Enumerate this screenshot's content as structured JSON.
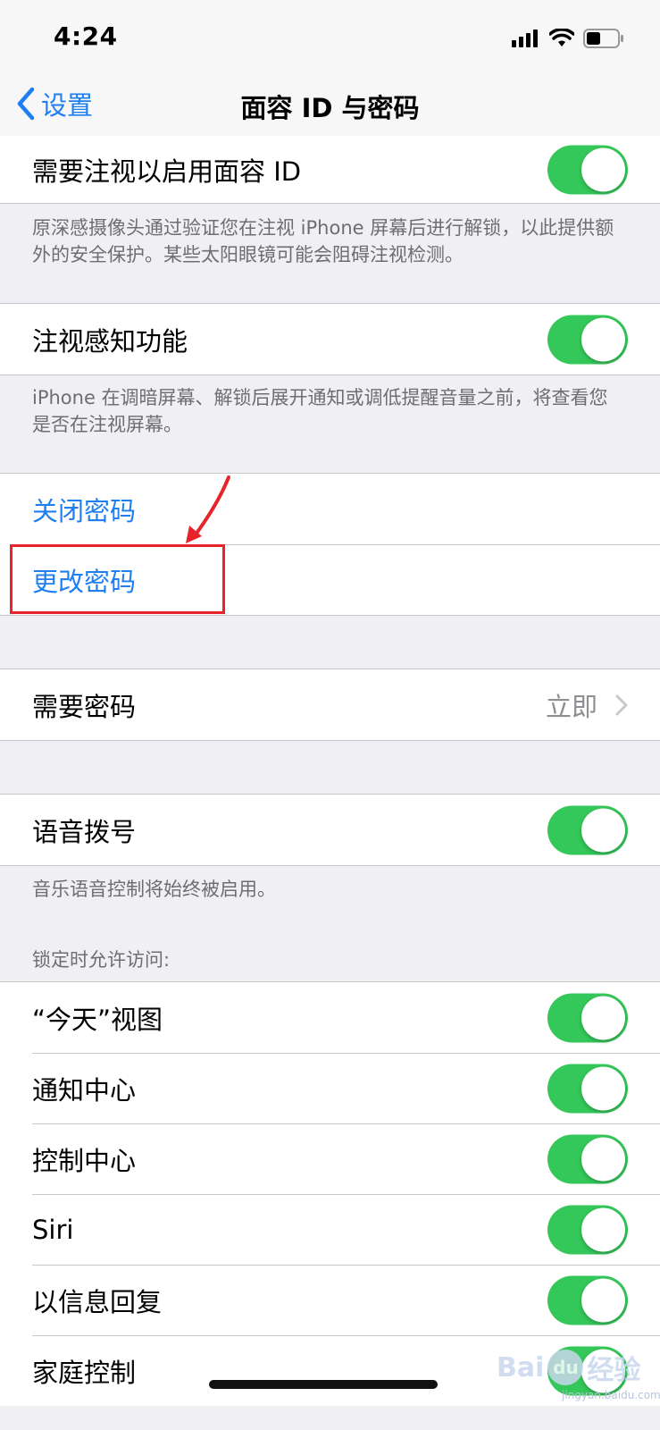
{
  "status_bar": {
    "time": "4:24"
  },
  "nav": {
    "back_label": "设置",
    "title": "面容 ID 与密码"
  },
  "attention": {
    "label": "需要注视以启用面容 ID",
    "enabled": true,
    "footnote": "原深感摄像头通过验证您在注视 iPhone 屏幕后进行解锁，以此提供额外的安全保护。某些太阳眼镜可能会阻碍注视检测。"
  },
  "attention_aware": {
    "label": "注视感知功能",
    "enabled": true,
    "footnote": "iPhone 在调暗屏幕、解锁后展开通知或调低提醒音量之前，将查看您是否在注视屏幕。"
  },
  "passcode": {
    "turn_off": "关闭密码",
    "change": "更改密码"
  },
  "require_passcode": {
    "label": "需要密码",
    "value": "立即"
  },
  "voice_dial": {
    "label": "语音拨号",
    "enabled": true,
    "footnote": "音乐语音控制将始终被启用。"
  },
  "locked_access": {
    "header": "锁定时允许访问:",
    "items": [
      {
        "label": "“今天”视图",
        "enabled": true
      },
      {
        "label": "通知中心",
        "enabled": true
      },
      {
        "label": "控制中心",
        "enabled": true
      },
      {
        "label": "Siri",
        "enabled": true
      },
      {
        "label": "以信息回复",
        "enabled": true
      },
      {
        "label": "家庭控制",
        "enabled": true
      }
    ]
  },
  "watermark": {
    "brand": "Bai",
    "logo": "du",
    "suffix": "经验",
    "url": "jingyan.baidu.com"
  },
  "colors": {
    "accent": "#1f7ef0",
    "toggle_on": "#34c759",
    "annotation": "#e8242b"
  }
}
